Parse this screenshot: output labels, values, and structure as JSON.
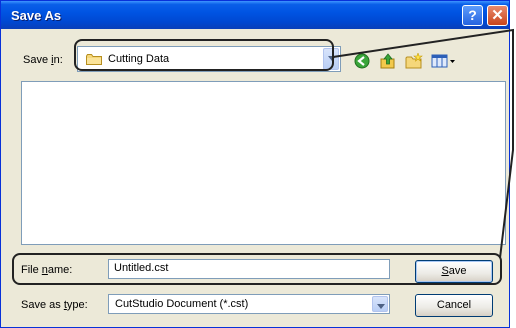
{
  "window": {
    "title": "Save As"
  },
  "titlebar": {
    "help_glyph": "?",
    "close_glyph": "✕"
  },
  "save_in": {
    "label_prefix": "Save ",
    "label_accel": "i",
    "label_suffix": "n:",
    "current_folder": "Cutting Data",
    "folder_icon": "folder-icon"
  },
  "toolbar": {
    "icons": [
      "back-icon",
      "up-folder-icon",
      "new-folder-icon",
      "views-menu-icon"
    ]
  },
  "file_name": {
    "label_prefix": "File ",
    "label_accel": "n",
    "label_suffix": "ame:",
    "value": "Untitled.cst"
  },
  "save_as_type": {
    "label_prefix": "Save as ",
    "label_accel": "t",
    "label_suffix": "ype:",
    "value": "CutStudio Document (*.cst)"
  },
  "buttons": {
    "save_accel": "S",
    "save_rest": "ave",
    "cancel": "Cancel"
  },
  "colors": {
    "titlebar": "#0054e3",
    "dialog_bg": "#ece9d8",
    "close_button": "#c9451c"
  }
}
